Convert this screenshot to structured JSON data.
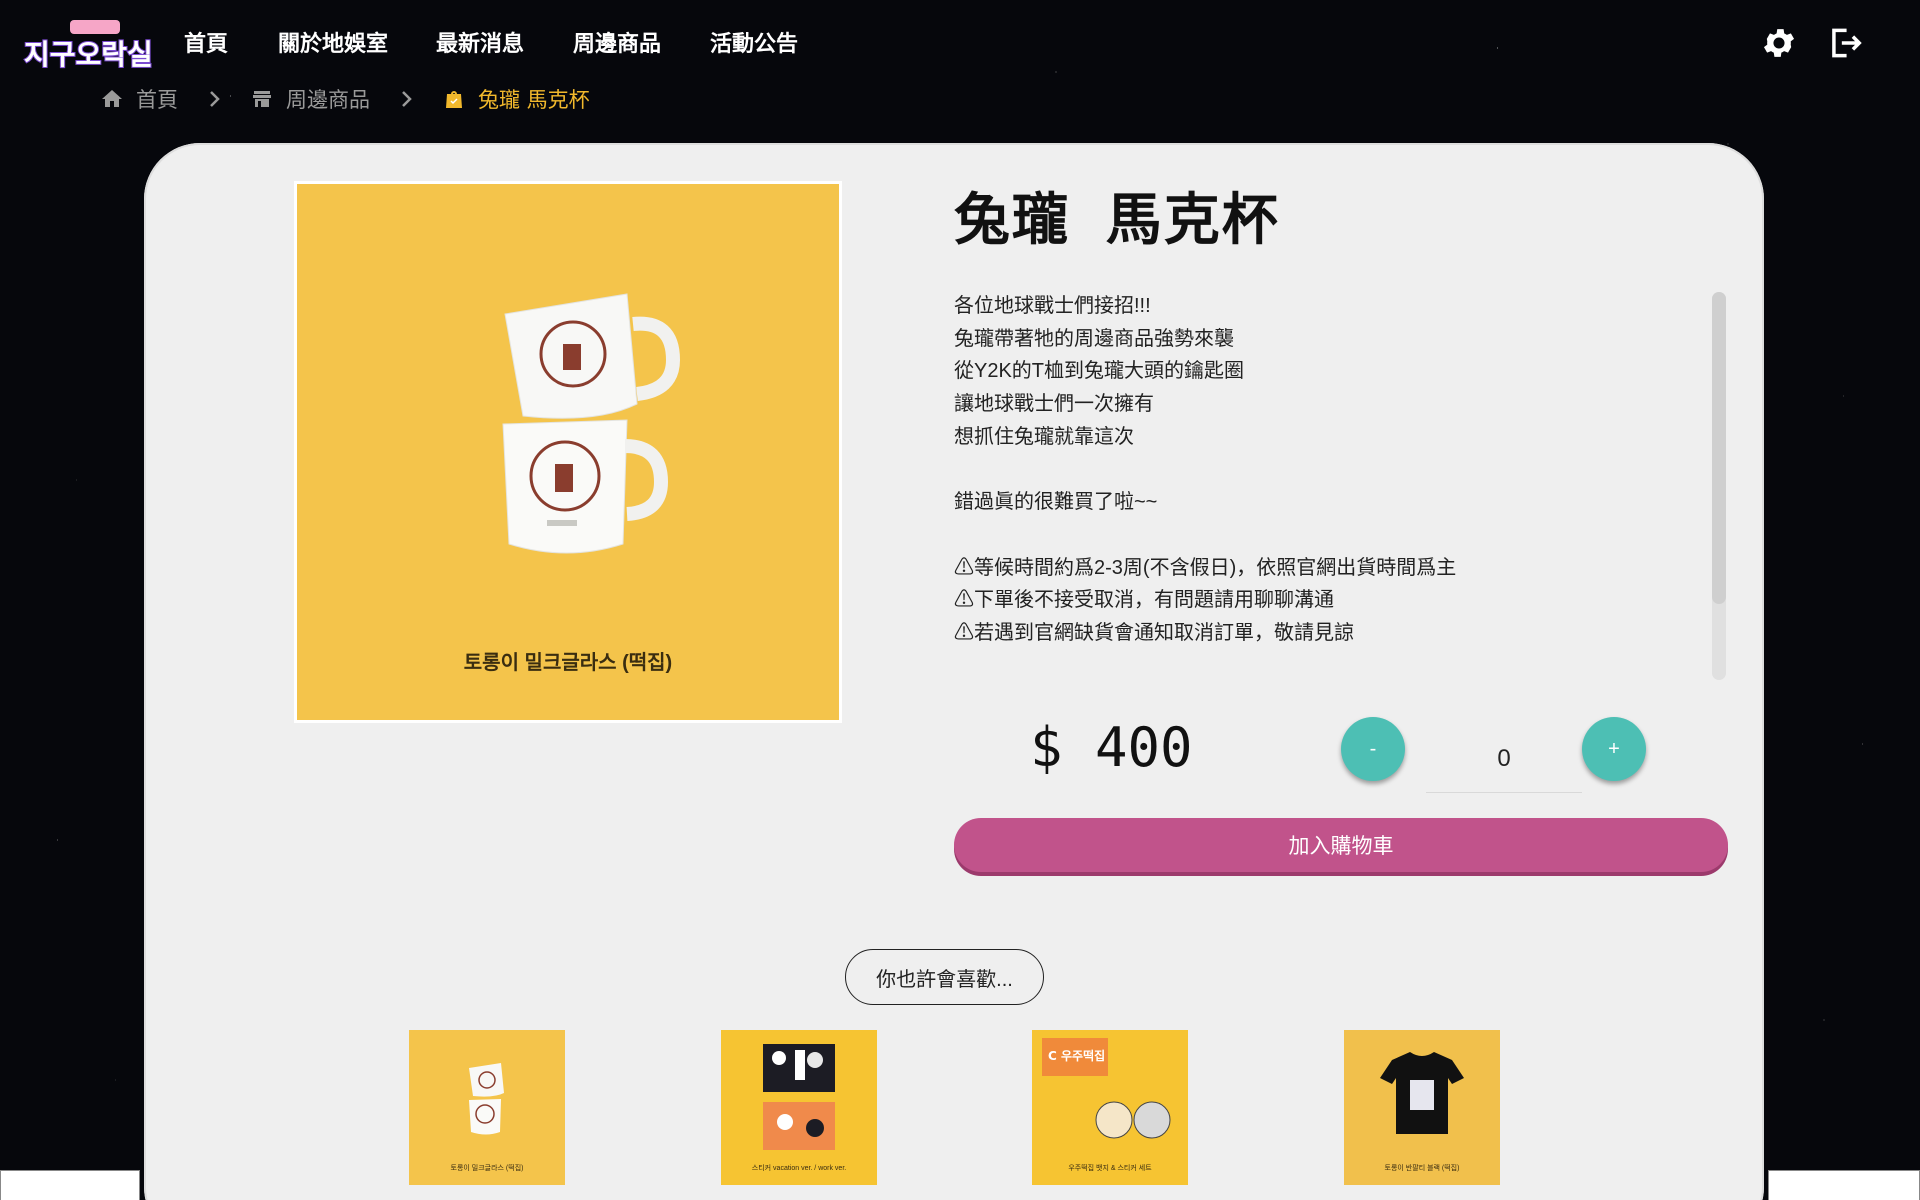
{
  "nav": {
    "logo_text": "지구오락실",
    "links": [
      "首頁",
      "關於地娛室",
      "最新消息",
      "周邊商品",
      "活動公告"
    ]
  },
  "breadcrumb": {
    "home": "首頁",
    "shop": "周邊商品",
    "current": "兔瓏 馬克杯"
  },
  "product": {
    "title": "兔瓏 馬克杯",
    "image_caption": "토롱이 밀크글라스 (떡집)",
    "description": [
      "各位地球戰士們接招!!!",
      "兔瓏帶著牠的周邊商品強勢來襲",
      "從Y2K的T桖到兔瓏大頭的鑰匙圈",
      "讓地球戰士們一次擁有",
      "想抓住兔瓏就靠這次",
      "",
      "錯過眞的很難買了啦~~",
      "",
      "⚠等候時間約爲2-3周(不含假日)，依照官網出貨時間爲主",
      "⚠下單後不接受取消，有問題請用聊聊溝通",
      "⚠若遇到官網缺貨會通知取消訂單，敬請見諒"
    ],
    "price": "$ 400",
    "quantity": "0",
    "minus_label": "-",
    "plus_label": "+",
    "add_to_cart": "加入購物車"
  },
  "suggest": {
    "label": "你也許會喜歡...",
    "items": [
      {
        "caption": "토롱이 밀크글라스 (떡집)"
      },
      {
        "caption": "스티커 vacation ver. / work ver."
      },
      {
        "caption": "우주떡집 뱃지 & 스티커 세트"
      },
      {
        "caption": "토롱이 반팔티 블랙 (떡집)"
      }
    ]
  },
  "colors": {
    "accent_teal": "#4dbfb4",
    "cart_pink": "#c1538b",
    "crumb_active": "#f1b82c",
    "product_bg": "#f4c44b"
  },
  "icons": [
    "home-icon",
    "store-icon",
    "bag-icon",
    "chevron-right-icon",
    "gear-icon",
    "logout-icon"
  ]
}
